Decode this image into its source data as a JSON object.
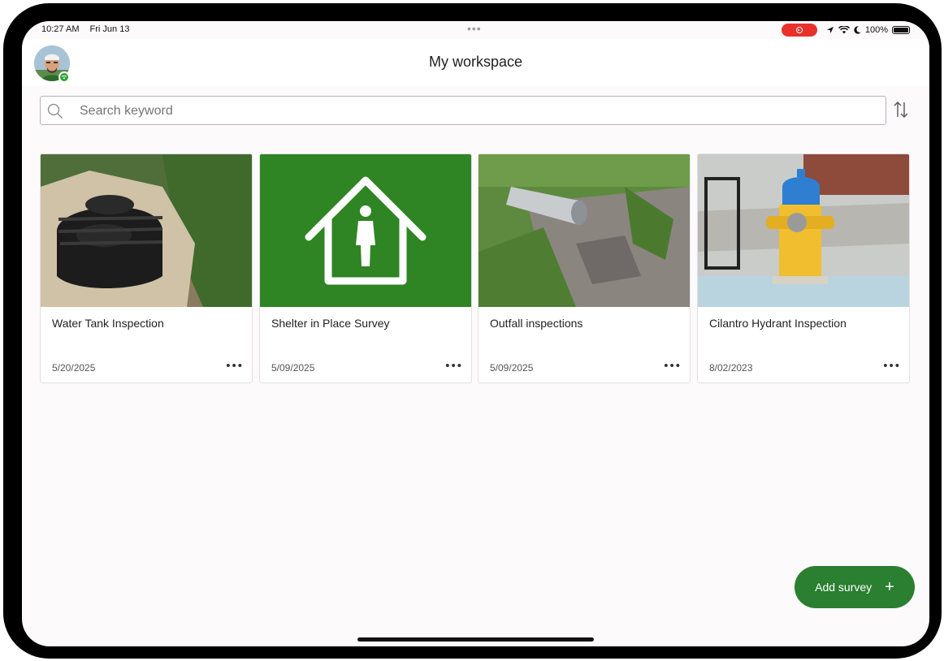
{
  "status_bar": {
    "time": "10:27 AM",
    "date": "Fri Jun 13",
    "multitask_dots": "•••",
    "battery": "100%"
  },
  "header": {
    "title": "My workspace"
  },
  "search": {
    "placeholder": "Search keyword"
  },
  "surveys": [
    {
      "title": "Water Tank Inspection",
      "date": "5/20/2025",
      "more": "•••"
    },
    {
      "title": "Shelter in Place Survey",
      "date": "5/09/2025",
      "more": "•••"
    },
    {
      "title": "Outfall inspections",
      "date": "5/09/2025",
      "more": "•••"
    },
    {
      "title": "Cilantro Hydrant Inspection",
      "date": "8/02/2023",
      "more": "•••"
    }
  ],
  "fab": {
    "label": "Add survey",
    "icon": "plus-icon"
  },
  "colors": {
    "accent": "#2a7f30",
    "recording": "#e8312b",
    "background": "#fdfafc"
  }
}
